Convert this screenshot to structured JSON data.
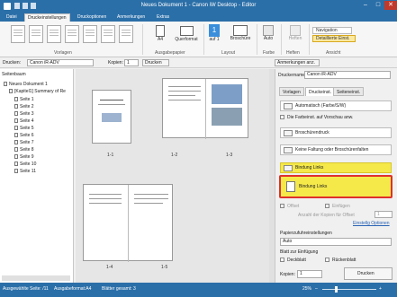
{
  "window": {
    "title": "Neues Dokument 1 - Canon iW Desktop - Editor"
  },
  "menu": {
    "tabs": [
      "Datei",
      "Druckeinstellungen",
      "Druckoptionen",
      "Anmerkungen",
      "Extras"
    ],
    "active": 1
  },
  "ribbon": {
    "groups": [
      "Vorlagen",
      "Ausgabepapier",
      "Layout",
      "Farbe",
      "Heften",
      "Ansicht"
    ],
    "output_size": "A4",
    "orientation": "Querformat",
    "pages_per_sheet": "1",
    "pages_per_sheet_sub": "auf 1",
    "booklet": "Broschüre",
    "color": "Auto",
    "staple": "Heften",
    "navigation": "Navigation",
    "detailed_settings": "Detaillierte Einst."
  },
  "toolbar": {
    "printer_label": "Drucken:",
    "printer_value": "Canon iR-ADV",
    "copies_label": "Kopien:",
    "copies_value": "1",
    "print_label": "Drucken",
    "annotate_label": "Anmerkungen anz."
  },
  "sidebar": {
    "header": "Seitenbaum",
    "items": [
      "Neues Dokument 1",
      "[Kapitel1] Summary of Re",
      "Seite 1",
      "Seite 2",
      "Seite 3",
      "Seite 4",
      "Seite 5",
      "Seite 6",
      "Seite 7",
      "Seite 8",
      "Seite 9",
      "Seite 10",
      "Seite 11"
    ]
  },
  "preview": {
    "labels": [
      "1-1",
      "1-2",
      "1-3",
      "1-4",
      "1-5"
    ]
  },
  "panel": {
    "printer_name_label": "Druckername:",
    "printer_name_value": "Canon iR-ADV",
    "tabs": [
      "Vorlagen",
      "Druckeinst.",
      "Seiteneinst."
    ],
    "active_tab": 1,
    "color_mode": "Automatisch (Farbe/S/W)",
    "apply_color_label": "Die Farbeinst. auf Vorschau anw.",
    "booklet_print": "Broschürendruck",
    "fold": "Keine Faltung oder Broschürenfalten",
    "binding": "Bindung Links",
    "binding_highlight": "Bindung Links",
    "offset_label": "Offset",
    "insert_label": "Einfügen",
    "offset_copies_label": "Anzahl der Kopien für Offset",
    "offset_copies_value": "1",
    "finishing_label": "Einstellg Optionen",
    "paper_source_label": "Papierzufuhreinstellungen",
    "paper_source_value": "Auto",
    "insert_sheet_label": "Blatt zur Einfügung",
    "cover_label": "Deckblatt",
    "back_cover_label": "Rückenblatt",
    "copies_label": "Kopien:",
    "copies_value": "1",
    "print_button": "Drucken"
  },
  "status": {
    "selected_page": "Ausgewählte Seite: /11",
    "output_format": "Ausgabeformat:A4",
    "sheets_total": "Blätter gesamt: 3",
    "zoom": "25%"
  },
  "colors": {
    "titlebar": "#2b6fa8",
    "highlight": "#f5e94a",
    "highlight_border": "#e0302c"
  }
}
